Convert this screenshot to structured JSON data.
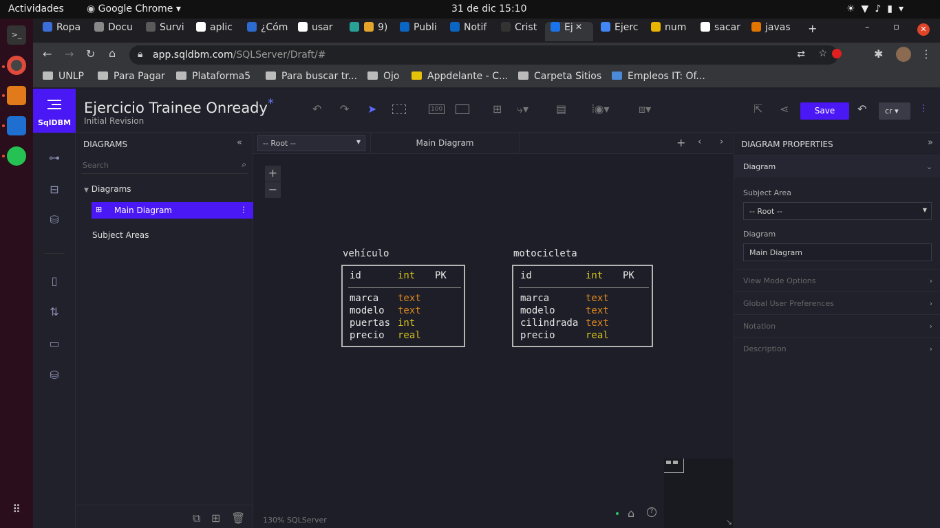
{
  "system": {
    "activities": "Actividades",
    "app_name": "Google Chrome",
    "clock": "31 de dic  15:10"
  },
  "tabs": [
    {
      "label": "Ropa",
      "color": "#3b6ed8"
    },
    {
      "label": "Docu",
      "color": "#888888"
    },
    {
      "label": "Survi",
      "color": "#5a5a5a"
    },
    {
      "label": "aplic",
      "color": "#ffffff"
    },
    {
      "label": "¿Cóm",
      "color": "#2d6bd1"
    },
    {
      "label": "usar",
      "color": "#ffffff"
    },
    {
      "label": "",
      "color": "#2aa198"
    },
    {
      "label": "9)",
      "color": "#e5a52a"
    },
    {
      "label": "Publi",
      "color": "#0a66c2"
    },
    {
      "label": "Notif",
      "color": "#0a66c2"
    },
    {
      "label": "Crist",
      "color": "#333333"
    },
    {
      "label": "Ej",
      "color": "#1a73e8"
    },
    {
      "label": "Ejerc",
      "color": "#4285f4"
    },
    {
      "label": "num",
      "color": "#e8b400"
    },
    {
      "label": "sacar",
      "color": "#ffffff"
    },
    {
      "label": "javas",
      "color": "#e37400"
    }
  ],
  "address": {
    "host": "app.sqldbm.com",
    "path": "/SQLServer/Draft/#"
  },
  "bookmarks": [
    "UNLP",
    "Para Pagar",
    "Plataforma5",
    "Para buscar tr...",
    "Ojo",
    "Appdelante - C...",
    "Carpeta Sitios",
    "Empleos IT: Of..."
  ],
  "app": {
    "logo": "SqlDBM",
    "title": "Ejercicio Trainee Onready",
    "title_mark": "*",
    "subtitle": "Initial Revision",
    "save": "Save",
    "user": "cr"
  },
  "sidebar": {
    "title": "DIAGRAMS",
    "search_placeholder": "Search",
    "tree_root": "Diagrams",
    "selected": "Main Diagram",
    "subject_areas": "Subject Areas"
  },
  "canvas": {
    "root_select": "-- Root --",
    "tab": "Main Diagram",
    "zoom": "130%",
    "db": "SQLServer"
  },
  "tables": [
    {
      "name": "vehículo",
      "pk": {
        "col": "id",
        "type": "int",
        "key": "PK"
      },
      "cols": [
        {
          "col": "marca",
          "type": "text"
        },
        {
          "col": "modelo",
          "type": "text"
        },
        {
          "col": "puertas",
          "type": "int"
        },
        {
          "col": "precio",
          "type": "real"
        }
      ]
    },
    {
      "name": "motocicleta",
      "pk": {
        "col": "id",
        "type": "int",
        "key": "PK"
      },
      "cols": [
        {
          "col": "marca",
          "type": "text"
        },
        {
          "col": "modelo",
          "type": "text"
        },
        {
          "col": "cilindrada",
          "type": "text"
        },
        {
          "col": "precio",
          "type": "real"
        }
      ]
    }
  ],
  "colors": {
    "accent": "#4a17f5",
    "type_text": "#e08a1e",
    "type_int": "#d7c31b",
    "type_real": "#d7c31b"
  },
  "properties": {
    "title": "DIAGRAM PROPERTIES",
    "section": "Diagram",
    "subject_area_label": "Subject Area",
    "subject_area_value": "-- Root --",
    "diagram_label": "Diagram",
    "diagram_value": "Main Diagram",
    "sections": [
      "View Mode Options",
      "Global User Preferences",
      "Notation",
      "Description"
    ]
  }
}
